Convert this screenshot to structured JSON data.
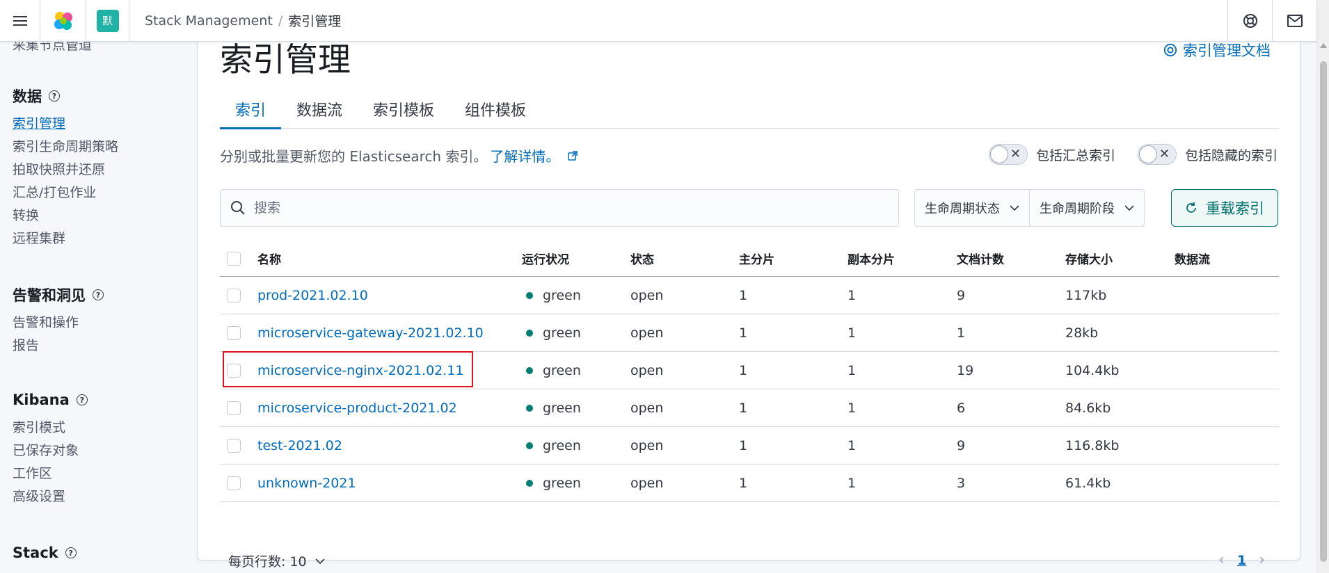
{
  "header": {
    "space_badge": "默",
    "breadcrumbs": [
      "Stack Management",
      "索引管理"
    ]
  },
  "sidebar": {
    "cut_item": "采集节点管道",
    "sections": [
      {
        "title": "数据",
        "items": [
          "索引管理",
          "索引生命周期策略",
          "拍取快照并还原",
          "汇总/打包作业",
          "转换",
          "远程集群"
        ]
      },
      {
        "title": "告警和洞见",
        "items": [
          "告警和操作",
          "报告"
        ]
      },
      {
        "title": "Kibana",
        "items": [
          "索引模式",
          "已保存对象",
          "工作区",
          "高级设置"
        ]
      },
      {
        "title": "Stack",
        "items": []
      }
    ],
    "active_item": "索引管理"
  },
  "main": {
    "title": "索引管理",
    "doc_link": "索引管理文档",
    "tabs": [
      "索引",
      "数据流",
      "索引模板",
      "组件模板"
    ],
    "active_tab": "索引",
    "description": "分别或批量更新您的 Elasticsearch 索引。",
    "learn_more": "了解详情。",
    "toggles": [
      "包括汇总索引",
      "包括隐藏的索引"
    ],
    "search_placeholder": "搜索",
    "filters": [
      "生命周期状态",
      "生命周期阶段"
    ],
    "reload_label": "重载索引",
    "columns": [
      "名称",
      "运行状况",
      "状态",
      "主分片",
      "副本分片",
      "文档计数",
      "存储大小",
      "数据流"
    ],
    "rows": [
      {
        "name": "prod-2021.02.10",
        "health": "green",
        "status": "open",
        "primary": "1",
        "replicas": "1",
        "docs": "9",
        "size": "117kb",
        "data_stream": ""
      },
      {
        "name": "microservice-gateway-2021.02.10",
        "health": "green",
        "status": "open",
        "primary": "1",
        "replicas": "1",
        "docs": "1",
        "size": "28kb",
        "data_stream": ""
      },
      {
        "name": "microservice-nginx-2021.02.11",
        "health": "green",
        "status": "open",
        "primary": "1",
        "replicas": "1",
        "docs": "19",
        "size": "104.4kb",
        "data_stream": ""
      },
      {
        "name": "microservice-product-2021.02",
        "health": "green",
        "status": "open",
        "primary": "1",
        "replicas": "1",
        "docs": "6",
        "size": "84.6kb",
        "data_stream": ""
      },
      {
        "name": "test-2021.02",
        "health": "green",
        "status": "open",
        "primary": "1",
        "replicas": "1",
        "docs": "9",
        "size": "116.8kb",
        "data_stream": ""
      },
      {
        "name": "unknown-2021",
        "health": "green",
        "status": "open",
        "primary": "1",
        "replicas": "1",
        "docs": "3",
        "size": "61.4kb",
        "data_stream": ""
      }
    ],
    "rows_per_page": "每页行数: 10",
    "current_page": "1"
  },
  "colors": {
    "link": "#006bb8",
    "health_green": "#017d73",
    "accent_teal": "#00726b",
    "highlight_red": "#e0101e"
  }
}
